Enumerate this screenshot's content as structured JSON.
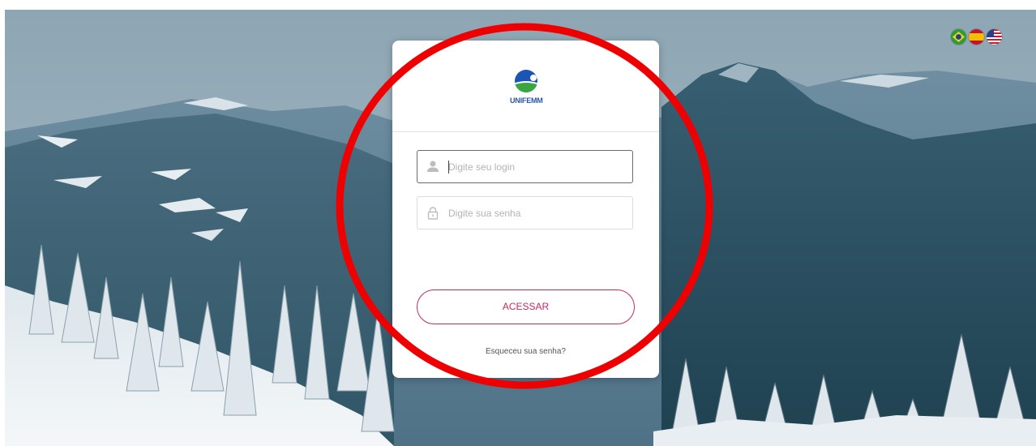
{
  "brand": {
    "name": "UNIFEMM",
    "colors": {
      "blue": "#1c55b4",
      "green": "#3aa641",
      "accent": "#c72a5c"
    }
  },
  "languages": [
    {
      "code": "pt-BR",
      "icon": "brazil-flag-icon"
    },
    {
      "code": "es",
      "icon": "spain-flag-icon"
    },
    {
      "code": "en-US",
      "icon": "usa-flag-icon"
    }
  ],
  "login": {
    "user_placeholder": "Digite seu login",
    "user_icon": "user-icon",
    "password_placeholder": "Digite sua senha",
    "password_icon": "lock-icon",
    "submit_label": "ACESSAR",
    "forgot_label": "Esqueceu sua senha?"
  },
  "annotation": {
    "shape": "ellipse",
    "color": "#ee0000"
  }
}
